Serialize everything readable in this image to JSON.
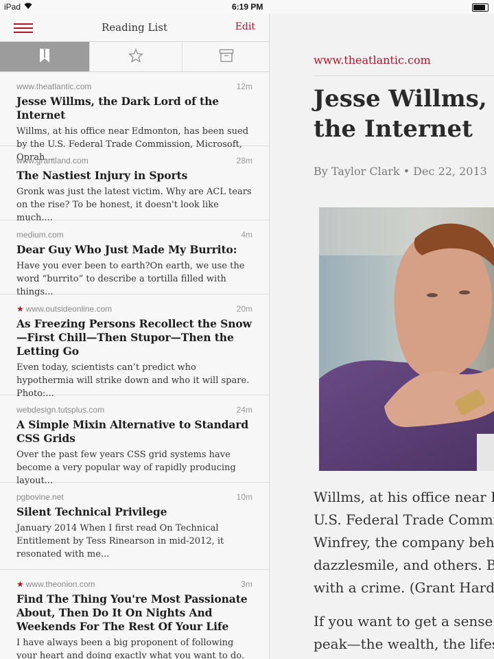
{
  "status_bar": {
    "carrier": "iPad",
    "time": "6:19 PM"
  },
  "nav": {
    "title": "Reading List",
    "edit_label": "Edit"
  },
  "tabs": [
    {
      "icon": "bookmark-icon",
      "active": true
    },
    {
      "icon": "star-icon",
      "active": false
    },
    {
      "icon": "archive-icon",
      "active": false
    }
  ],
  "articles": [
    {
      "source": "www.theatlantic.com",
      "age": "12m",
      "starred": false,
      "title": "Jesse Willms, the Dark Lord of the Internet",
      "excerpt": "Willms, at his office near Edmonton, has been sued by the U.S. Federal Trade Commission, Microsoft, Oprah..."
    },
    {
      "source": "www.grantland.com",
      "age": "28m",
      "starred": false,
      "title": "The Nastiest Injury in Sports",
      "excerpt": "Gronk was just the latest victim. Why are ACL tears on the rise? To be honest, it doesn't look like much...."
    },
    {
      "source": "medium.com",
      "age": "4m",
      "starred": false,
      "title": "Dear Guy Who Just Made My Burrito:",
      "excerpt": "Have you ever been to earth?On earth, we use the word “burrito” to describe a tortilla filled with things..."
    },
    {
      "source": "www.outsideonline.com",
      "age": "20m",
      "starred": true,
      "title": "As Freezing Persons Recollect the Snow—First Chill—Then Stupor—Then the Letting Go",
      "excerpt": "Even today, scientists can’t predict who hypothermia will strike down and who it will spare.     Photo:..."
    },
    {
      "source": "webdesign.tutsplus.com",
      "age": "24m",
      "starred": false,
      "title": "A Simple Mixin Alternative to Standard CSS Grids",
      "excerpt": "Over the past few years CSS grid systems have become a very popular way of rapidly producing layout..."
    },
    {
      "source": "pgbovine.net",
      "age": "10m",
      "starred": false,
      "title": "Silent Technical Privilege",
      "excerpt": "January 2014 When I first read On Technical Entitlement by Tess Rinearson in mid-2012, it resonated with me..."
    },
    {
      "source": "www.theonion.com",
      "age": "3m",
      "starred": true,
      "title": "Find The Thing You're Most Passionate About, Then Do It On Nights And Weekends For The Rest Of Your Life",
      "excerpt": "I have always been a big proponent of following your heart and doing exactly what you want to do. It"
    }
  ],
  "reader": {
    "domain": "www.theatlantic.com",
    "headline_line1": "Jesse Willms, t",
    "headline_line2": "the Internet",
    "byline": "By Taylor Clark • Dec 22, 2013",
    "paragraph1": [
      "Willms, at his office near E",
      "U.S. Federal Trade Commi",
      "Winfrey, the company beh",
      "dazzlesmile, and others. B",
      "with a crime. (Grant Hard"
    ],
    "paragraph2": [
      "If you want to get a sense o",
      "peak—the wealth, the lifes"
    ]
  },
  "colors": {
    "accent": "#b5122a",
    "active_tab": "#9c9c9c",
    "background": "#f2f2f2"
  }
}
